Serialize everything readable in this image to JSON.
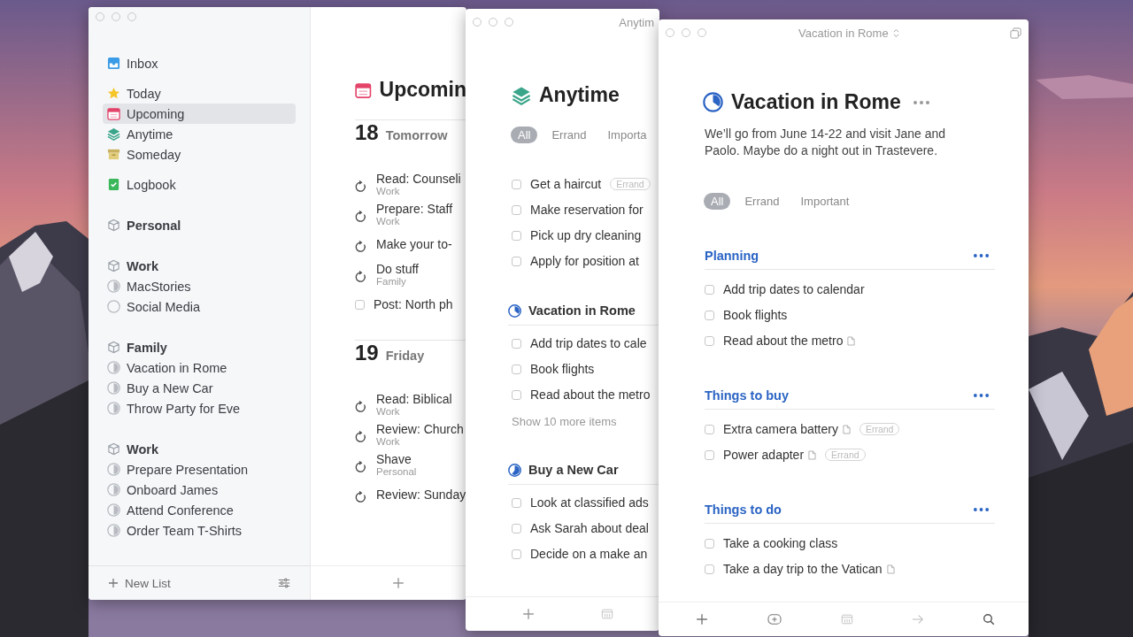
{
  "sidebar": {
    "groups": [
      {
        "items": [
          {
            "label": "Inbox",
            "kind": "inbox",
            "selected": false
          }
        ]
      },
      {
        "items": [
          {
            "label": "Today",
            "kind": "today",
            "selected": false
          },
          {
            "label": "Upcoming",
            "kind": "upcoming",
            "selected": true
          },
          {
            "label": "Anytime",
            "kind": "anytime",
            "selected": false
          },
          {
            "label": "Someday",
            "kind": "someday",
            "selected": false
          }
        ]
      },
      {
        "items": [
          {
            "label": "Logbook",
            "kind": "logbook",
            "selected": false
          }
        ]
      },
      {
        "items": [
          {
            "label": "Personal",
            "kind": "area",
            "selected": false
          }
        ]
      },
      {
        "items": [
          {
            "label": "Work",
            "kind": "area",
            "selected": false
          },
          {
            "label": "MacStories",
            "kind": "project",
            "selected": false
          },
          {
            "label": "Social Media",
            "kind": "new-project",
            "selected": false
          }
        ]
      },
      {
        "items": [
          {
            "label": "Family",
            "kind": "area",
            "selected": false
          },
          {
            "label": "Vacation in Rome",
            "kind": "project",
            "selected": false
          },
          {
            "label": "Buy a New Car",
            "kind": "project",
            "selected": false
          },
          {
            "label": "Throw Party for Eve",
            "kind": "project",
            "selected": false
          }
        ]
      },
      {
        "items": [
          {
            "label": "Work",
            "kind": "area",
            "selected": false
          },
          {
            "label": "Prepare Presentation",
            "kind": "project",
            "selected": false
          },
          {
            "label": "Onboard James",
            "kind": "project",
            "selected": false
          },
          {
            "label": "Attend Conference",
            "kind": "project",
            "selected": false
          },
          {
            "label": "Order Team T-Shirts",
            "kind": "project",
            "selected": false
          }
        ]
      }
    ],
    "new_list": "New List"
  },
  "upcoming": {
    "title": "Upcomin",
    "days": [
      {
        "date": "18",
        "label": "Tomorrow",
        "tasks": [
          {
            "title": "Read: Counseli",
            "subtitle": "Work",
            "kind": "repeat"
          },
          {
            "title": "Prepare: Staff",
            "subtitle": "Work",
            "kind": "repeat"
          },
          {
            "title": "Make your to-",
            "kind": "repeat"
          },
          {
            "title": "Do stuff",
            "subtitle": "Family",
            "kind": "repeat"
          },
          {
            "title": "Post: North ph",
            "kind": "todo",
            "checked": false
          }
        ]
      },
      {
        "date": "19",
        "label": "Friday",
        "tasks": [
          {
            "title": "Read: Biblical",
            "subtitle": "Work",
            "kind": "repeat"
          },
          {
            "title": "Review: Church",
            "subtitle": "Work",
            "kind": "repeat"
          },
          {
            "title": "Shave",
            "subtitle": "Personal",
            "kind": "repeat"
          },
          {
            "title": "Review: Sunday",
            "kind": "repeat"
          }
        ]
      }
    ]
  },
  "anytime": {
    "window_title": "Anytim",
    "title": "Anytime",
    "filters": [
      {
        "label": "All",
        "selected": true
      },
      {
        "label": "Errand",
        "selected": false
      },
      {
        "label": "Importa",
        "selected": false
      }
    ],
    "tasks": [
      {
        "title": "Get a haircut",
        "tag": "Errand",
        "checked": false
      },
      {
        "title": "Make reservation for",
        "checked": false
      },
      {
        "title": "Pick up dry cleaning",
        "checked": false
      },
      {
        "title": "Apply for position at",
        "checked": false
      }
    ],
    "projects": [
      {
        "title": "Vacation in Rome",
        "tasks": [
          {
            "title": "Add trip dates to cale",
            "checked": false
          },
          {
            "title": "Book flights",
            "checked": false
          },
          {
            "title": "Read about the metro",
            "checked": false
          }
        ],
        "more": "Show 10 more items"
      },
      {
        "title": "Buy a New Car",
        "tasks": [
          {
            "title": "Look at classified ads",
            "checked": false
          },
          {
            "title": "Ask Sarah about deal",
            "checked": false
          },
          {
            "title": "Decide on a make an",
            "checked": false
          }
        ]
      }
    ]
  },
  "rome": {
    "window_title": "Vacation in Rome",
    "title": "Vacation in Rome",
    "notes": "We’ll go from June 14-22 and visit Jane and Paolo. Maybe do a night out in Trastevere.",
    "filters": [
      {
        "label": "All",
        "selected": true
      },
      {
        "label": "Errand",
        "selected": false
      },
      {
        "label": "Important",
        "selected": false
      }
    ],
    "sections": [
      {
        "title": "Planning",
        "tasks": [
          {
            "title": "Add trip dates to calendar",
            "checked": false,
            "has_note": false
          },
          {
            "title": "Book flights",
            "checked": false,
            "has_note": false
          },
          {
            "title": "Read about the metro",
            "checked": false,
            "has_note": true
          }
        ]
      },
      {
        "title": "Things to buy",
        "tasks": [
          {
            "title": "Extra camera battery",
            "checked": false,
            "has_note": true,
            "tag": "Errand"
          },
          {
            "title": "Power adapter",
            "checked": false,
            "has_note": true,
            "tag": "Errand"
          }
        ]
      },
      {
        "title": "Things to do",
        "tasks": [
          {
            "title": "Take a cooking class",
            "checked": false,
            "has_note": false
          },
          {
            "title": "Take a day trip to the Vatican",
            "checked": false,
            "has_note": true
          }
        ]
      }
    ]
  }
}
